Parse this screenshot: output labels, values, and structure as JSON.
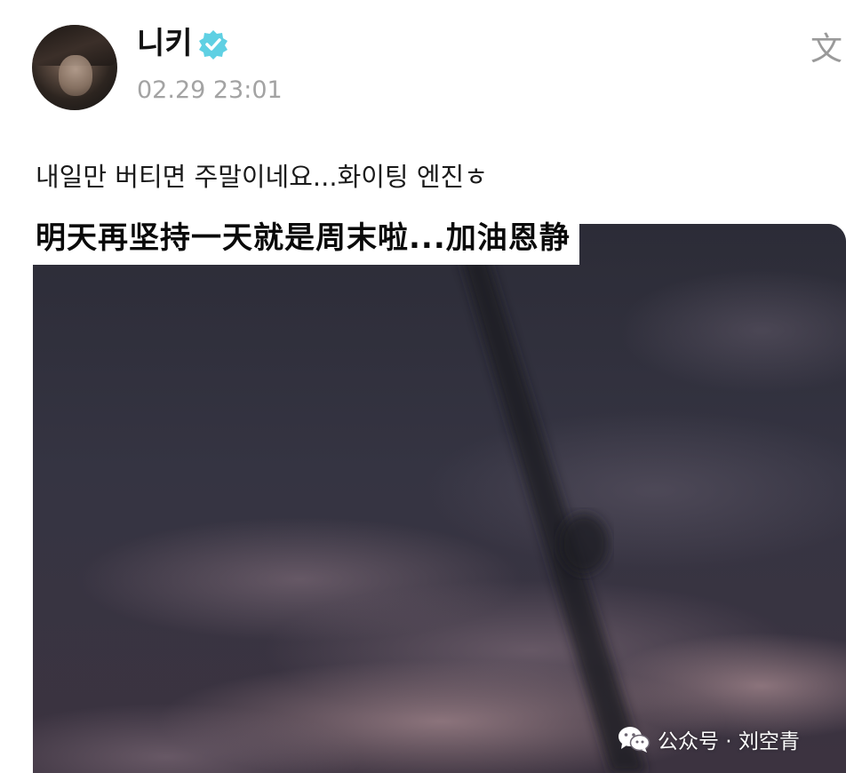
{
  "post": {
    "username": "니키",
    "timestamp": "02.29 23:01",
    "translate_icon_glyph": "文",
    "text_korean": "내일만 버티면 주말이네요...화이팅 엔진ㅎ",
    "subtitle_chinese": "明天再坚持一天就是周末啦...加油恩静"
  },
  "watermark": {
    "text": "公众号 · 刘空青"
  },
  "icons": {
    "verified": "verified-badge-icon",
    "translate": "translate-icon",
    "wechat": "wechat-icon"
  },
  "colors": {
    "verified_badge": "#5fd0e3",
    "timestamp": "#a3a3a3",
    "text": "#1a1a1a"
  }
}
